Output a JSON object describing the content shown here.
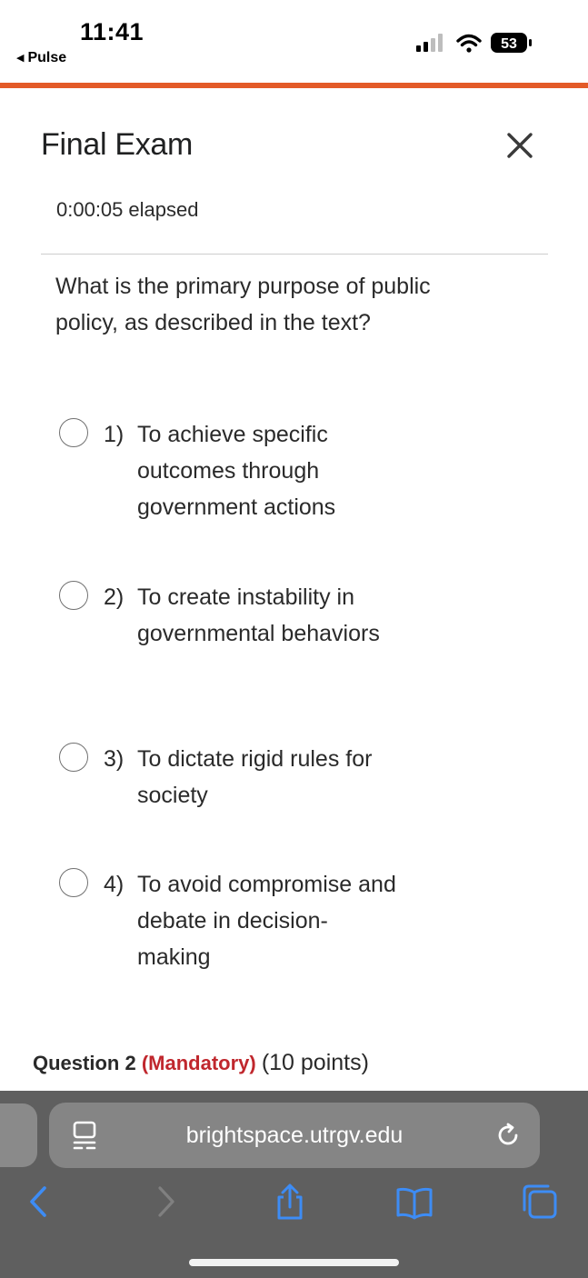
{
  "status_bar": {
    "time": "11:41",
    "back_app": "Pulse",
    "battery": "53",
    "icons": [
      "cellular-signal-icon",
      "wifi-icon",
      "battery-icon"
    ]
  },
  "header": {
    "title": "Final Exam",
    "close_icon": "close-icon",
    "accent_color": "#e35a28"
  },
  "timer": {
    "value": "0:00:05",
    "label": "elapsed"
  },
  "question": {
    "text": "What is the primary purpose of public policy, as described in the text?",
    "options": [
      {
        "number": "1)",
        "text": "To achieve specific outcomes through government actions",
        "selected": false
      },
      {
        "number": "2)",
        "text": "To create instability in governmental behaviors",
        "selected": false
      },
      {
        "number": "3)",
        "text": "To dictate rigid rules for society",
        "selected": false
      },
      {
        "number": "4)",
        "text": "To avoid compromise and debate in decision-making",
        "selected": false
      }
    ]
  },
  "next_question": {
    "label": "Question 2",
    "mandatory": "(Mandatory)",
    "points": "(10 points)",
    "mandatory_color": "#c0272d"
  },
  "browser": {
    "url": "brightspace.utrgv.edu",
    "icons": [
      "page-menu-icon",
      "reload-icon",
      "back-icon",
      "forward-icon",
      "share-icon",
      "bookmarks-icon",
      "tabs-icon"
    ],
    "link_color": "#3d8cf5"
  }
}
